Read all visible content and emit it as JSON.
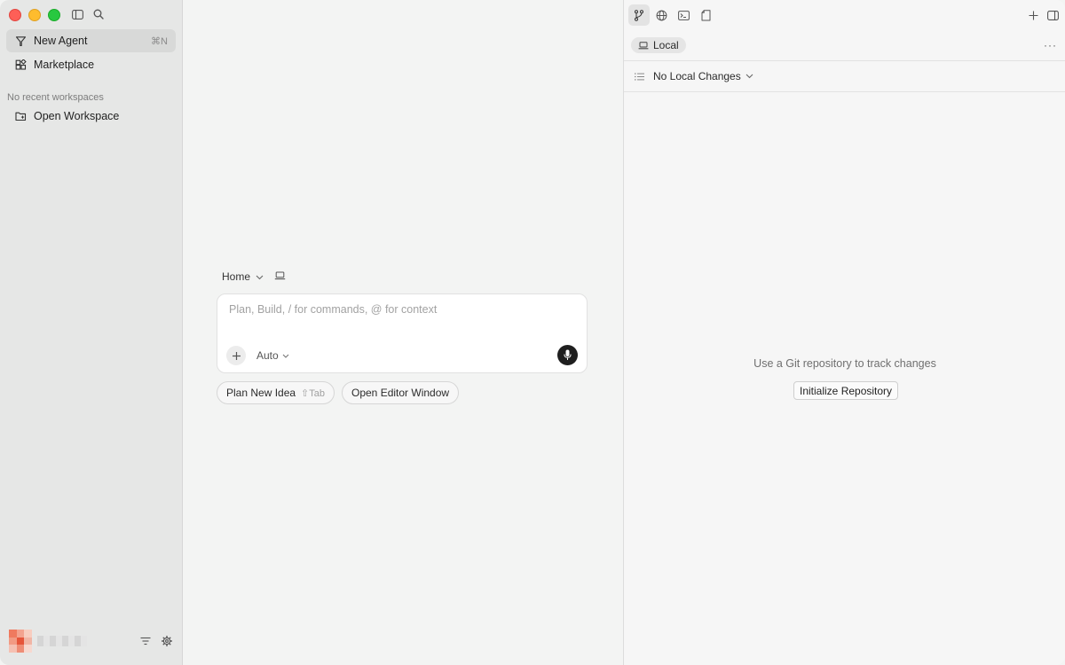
{
  "sidebar": {
    "nav": [
      {
        "label": "New Agent",
        "shortcut": "⌘N",
        "icon": "agent-icon"
      },
      {
        "label": "Marketplace",
        "icon": "marketplace-icon"
      }
    ],
    "recent_label": "No recent workspaces",
    "open_workspace_label": "Open Workspace"
  },
  "main": {
    "crumb": "Home",
    "composer": {
      "placeholder": "Plan, Build, / for commands, @ for context",
      "mode": "Auto"
    },
    "chips": [
      {
        "label": "Plan New Idea",
        "hint": "⇧Tab"
      },
      {
        "label": "Open Editor Window"
      }
    ]
  },
  "right": {
    "tabs": [
      "source-control-icon",
      "globe-icon",
      "terminal-icon",
      "file-icon"
    ],
    "local_label": "Local",
    "more": "···",
    "changes_label": "No Local Changes",
    "empty_message": "Use a Git repository to track changes",
    "init_button": "Initialize Repository"
  },
  "colors": {
    "close": "#fe5f57",
    "minimize": "#febc2e",
    "zoom": "#28c840",
    "mic_button": "#1f1f1f"
  }
}
